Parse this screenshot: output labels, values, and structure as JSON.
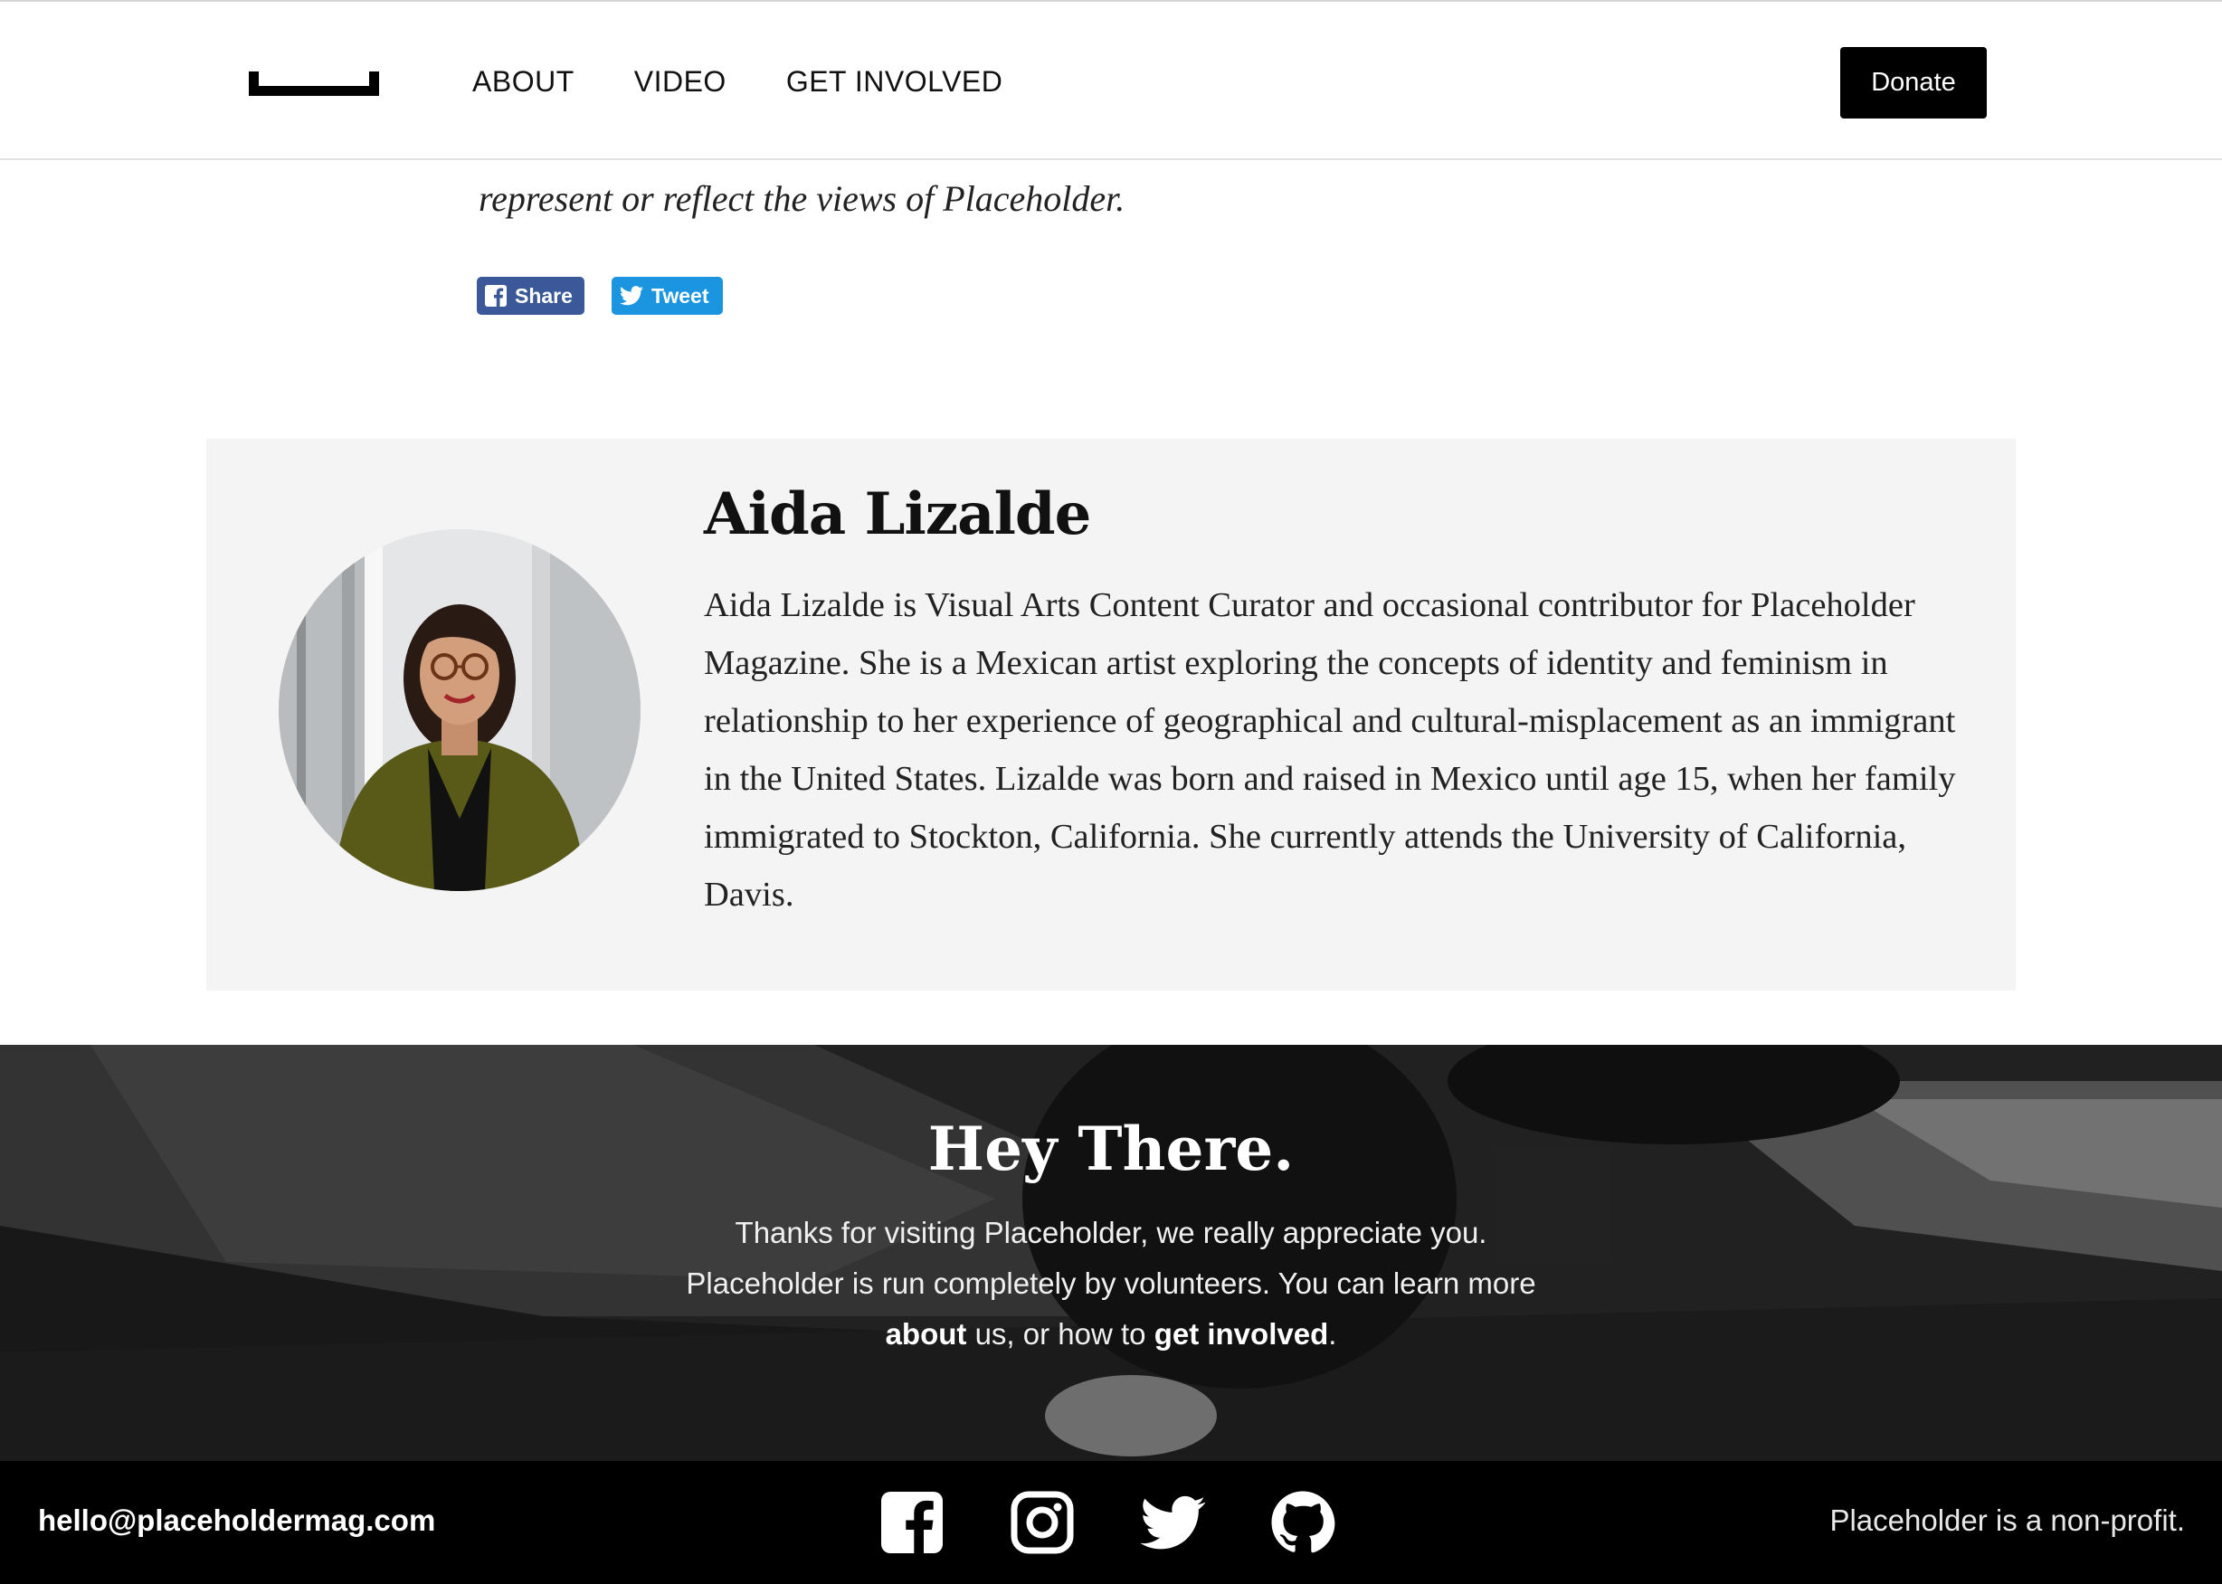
{
  "header": {
    "nav": [
      "ABOUT",
      "VIDEO",
      "GET INVOLVED"
    ],
    "donate_label": "Donate"
  },
  "article": {
    "disclaimer": "represent or reflect the views of Placeholder.",
    "share_label": "Share",
    "tweet_label": "Tweet"
  },
  "author": {
    "name": "Aida Lizalde",
    "bio": "Aida Lizalde is Visual Arts Content Curator and occasional contributor for Placeholder Magazine. She is a Mexican artist exploring the concepts of identity and feminism in relationship to her experience of geographical and cultural-misplacement as an immigrant in the United States. Lizalde was born and raised in Mexico until age 15, when her family immigrated to Stockton, California. She currently attends the University of California, Davis."
  },
  "cta": {
    "title": "Hey There.",
    "text_1": "Thanks for visiting Placeholder, we really appreciate you. Placeholder is run completely by volunteers. You can learn more",
    "link_about": "about",
    "text_2": "us, or how to",
    "link_involved": "get involved",
    "text_3": "."
  },
  "footer": {
    "email": "hello@placeholdermag.com",
    "icons": [
      "facebook-icon",
      "instagram-icon",
      "twitter-icon",
      "github-icon"
    ],
    "note": "Placeholder is a non-profit."
  },
  "colors": {
    "facebook": "#3b5998",
    "twitter": "#1b95e0",
    "bio_bg": "#f4f4f4",
    "footer_bg": "#000000"
  }
}
